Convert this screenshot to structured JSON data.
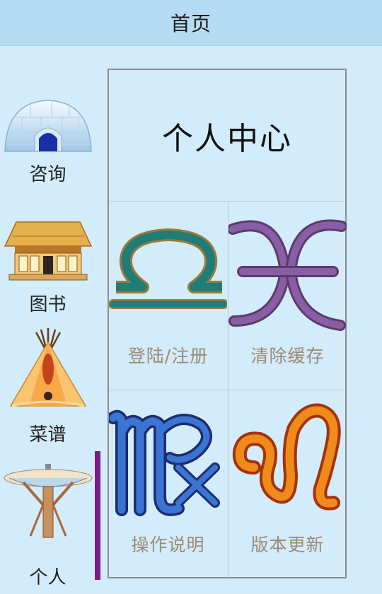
{
  "header": {
    "title": "首页"
  },
  "sidebar": {
    "items": [
      {
        "label": "咨询",
        "icon": "igloo-icon"
      },
      {
        "label": "图书",
        "icon": "pavilion-icon"
      },
      {
        "label": "菜谱",
        "icon": "teepee-icon"
      },
      {
        "label": "个人",
        "icon": "space-needle-icon",
        "active": true
      }
    ],
    "active_color": "#7a1d86"
  },
  "panel": {
    "title": "个人中心",
    "cells": [
      {
        "label": "登陆/注册",
        "icon": "libra-icon"
      },
      {
        "label": "清除缓存",
        "icon": "pisces-icon"
      },
      {
        "label": "操作说明",
        "icon": "virgo-icon"
      },
      {
        "label": "版本更新",
        "icon": "leo-icon"
      }
    ]
  }
}
